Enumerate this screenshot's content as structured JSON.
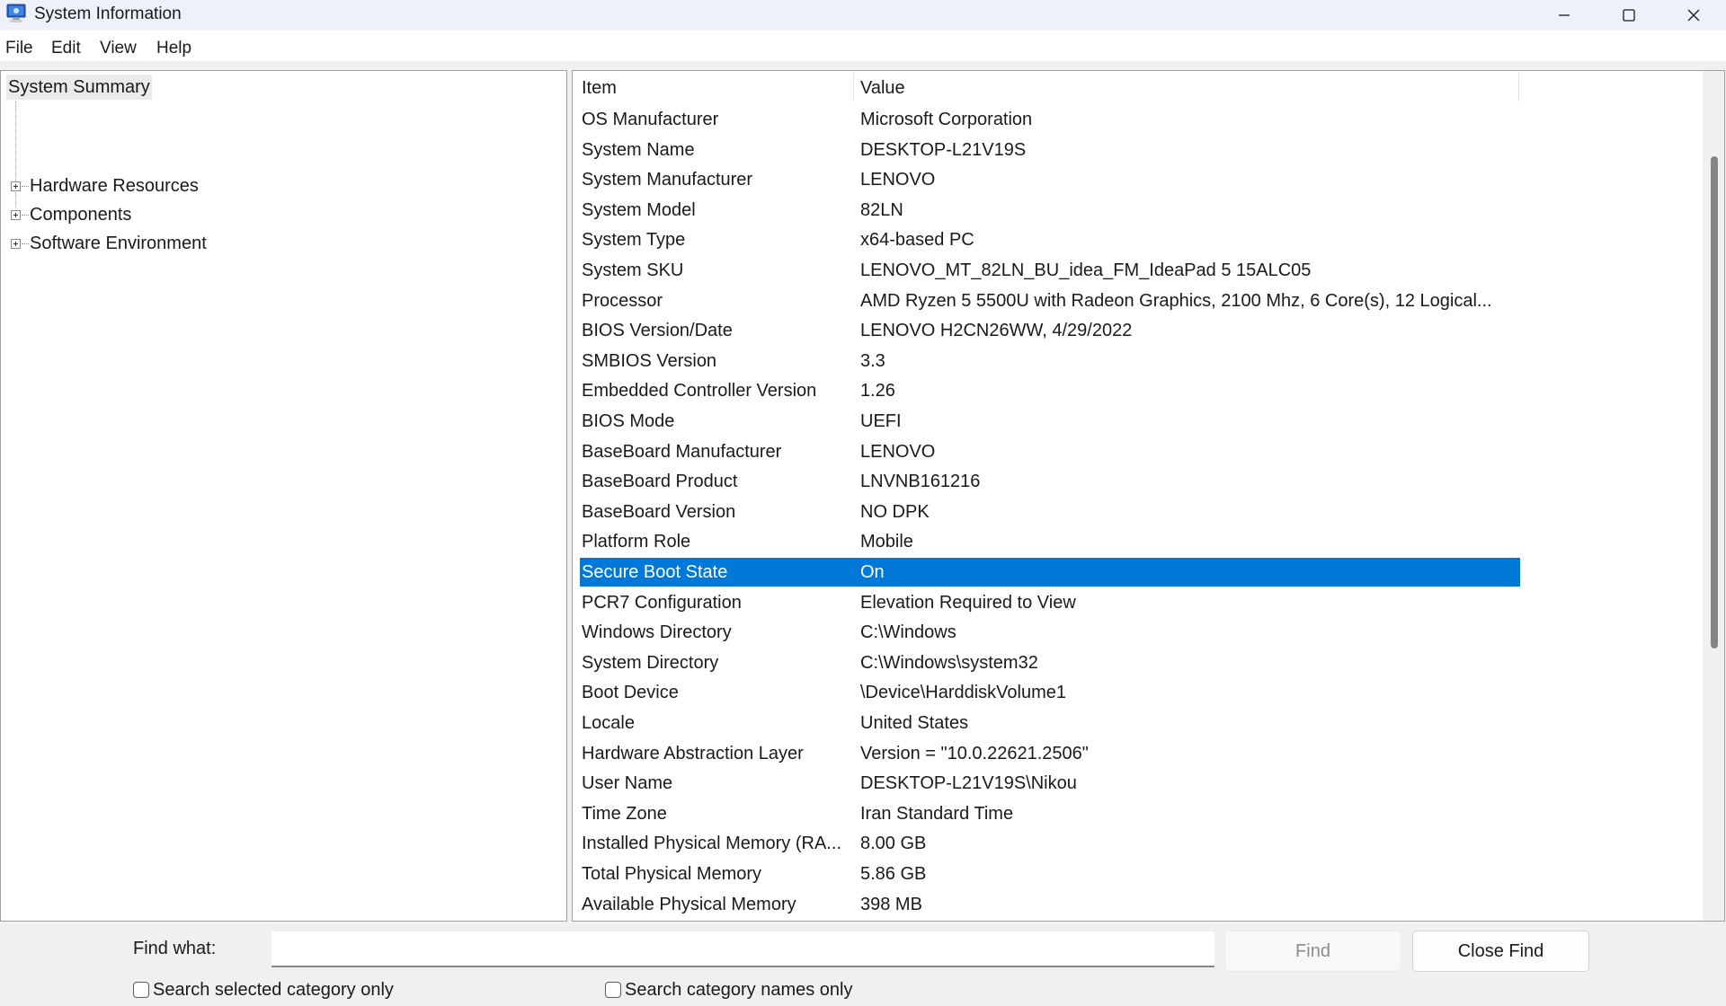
{
  "window": {
    "title": "System Information",
    "icon": "system-information-icon",
    "controls": [
      "minimize-icon",
      "maximize-icon",
      "close-icon"
    ]
  },
  "menu": [
    "File",
    "Edit",
    "View",
    "Help"
  ],
  "tree": {
    "root": "System Summary",
    "root_selected": true,
    "children": [
      {
        "label": "Hardware Resources",
        "expand": "plus-icon"
      },
      {
        "label": "Components",
        "expand": "plus-icon"
      },
      {
        "label": "Software Environment",
        "expand": "plus-icon"
      }
    ]
  },
  "list": {
    "columns": [
      "Item",
      "Value"
    ],
    "selected_index": 15,
    "selected_color": "#0078d7",
    "rows": [
      {
        "item": "OS Manufacturer",
        "value": "Microsoft Corporation"
      },
      {
        "item": "System Name",
        "value": "DESKTOP-L21V19S"
      },
      {
        "item": "System Manufacturer",
        "value": "LENOVO"
      },
      {
        "item": "System Model",
        "value": "82LN"
      },
      {
        "item": "System Type",
        "value": "x64-based PC"
      },
      {
        "item": "System SKU",
        "value": "LENOVO_MT_82LN_BU_idea_FM_IdeaPad 5 15ALC05"
      },
      {
        "item": "Processor",
        "value": "AMD Ryzen 5 5500U with Radeon Graphics, 2100 Mhz, 6 Core(s), 12 Logical..."
      },
      {
        "item": "BIOS Version/Date",
        "value": "LENOVO H2CN26WW, 4/29/2022"
      },
      {
        "item": "SMBIOS Version",
        "value": "3.3"
      },
      {
        "item": "Embedded Controller Version",
        "value": "1.26"
      },
      {
        "item": "BIOS Mode",
        "value": "UEFI"
      },
      {
        "item": "BaseBoard Manufacturer",
        "value": "LENOVO"
      },
      {
        "item": "BaseBoard Product",
        "value": "LNVNB161216"
      },
      {
        "item": "BaseBoard Version",
        "value": "NO DPK"
      },
      {
        "item": "Platform Role",
        "value": "Mobile"
      },
      {
        "item": "Secure Boot State",
        "value": "On"
      },
      {
        "item": "PCR7 Configuration",
        "value": "Elevation Required to View"
      },
      {
        "item": "Windows Directory",
        "value": "C:\\Windows"
      },
      {
        "item": "System Directory",
        "value": "C:\\Windows\\system32"
      },
      {
        "item": "Boot Device",
        "value": "\\Device\\HarddiskVolume1"
      },
      {
        "item": "Locale",
        "value": "United States"
      },
      {
        "item": "Hardware Abstraction Layer",
        "value": "Version = \"10.0.22621.2506\""
      },
      {
        "item": "User Name",
        "value": "DESKTOP-L21V19S\\Nikou"
      },
      {
        "item": "Time Zone",
        "value": "Iran Standard Time"
      },
      {
        "item": "Installed Physical Memory (RA...",
        "value": "8.00 GB"
      },
      {
        "item": "Total Physical Memory",
        "value": "5.86 GB"
      },
      {
        "item": "Available Physical Memory",
        "value": "398 MB"
      }
    ],
    "scroll": {
      "thumb_start_fraction": 0.1,
      "thumb_end_fraction": 0.68
    }
  },
  "find": {
    "label": "Find what:",
    "value": "",
    "find_button": "Find",
    "find_button_enabled": false,
    "close_button": "Close Find",
    "checkboxes": [
      {
        "label": "Search selected category only",
        "checked": false
      },
      {
        "label": "Search category names only",
        "checked": false
      }
    ]
  }
}
